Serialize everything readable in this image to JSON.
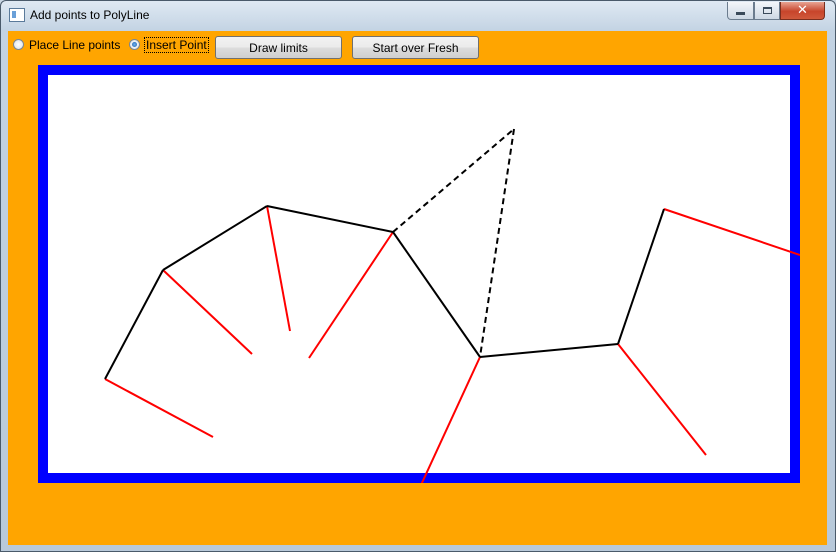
{
  "window": {
    "title": "Add points to PolyLine",
    "controls": {
      "minimize": "minimize",
      "maximize": "maximize",
      "close": "close"
    }
  },
  "toolbar": {
    "radio_place_label": "Place Line points",
    "radio_place_checked": false,
    "radio_insert_label": "Insert Point",
    "radio_insert_checked": true,
    "draw_limits_label": "Draw limits",
    "start_over_label": "Start over Fresh"
  },
  "colors": {
    "background": "#ffa500",
    "canvas_border": "#0000ff",
    "canvas_fill": "#ffffff",
    "polyline": "#000000",
    "limit_lines": "#ff0000"
  },
  "icons": [
    "app-window-icon",
    "minimize-icon",
    "maximize-icon",
    "close-icon"
  ]
}
